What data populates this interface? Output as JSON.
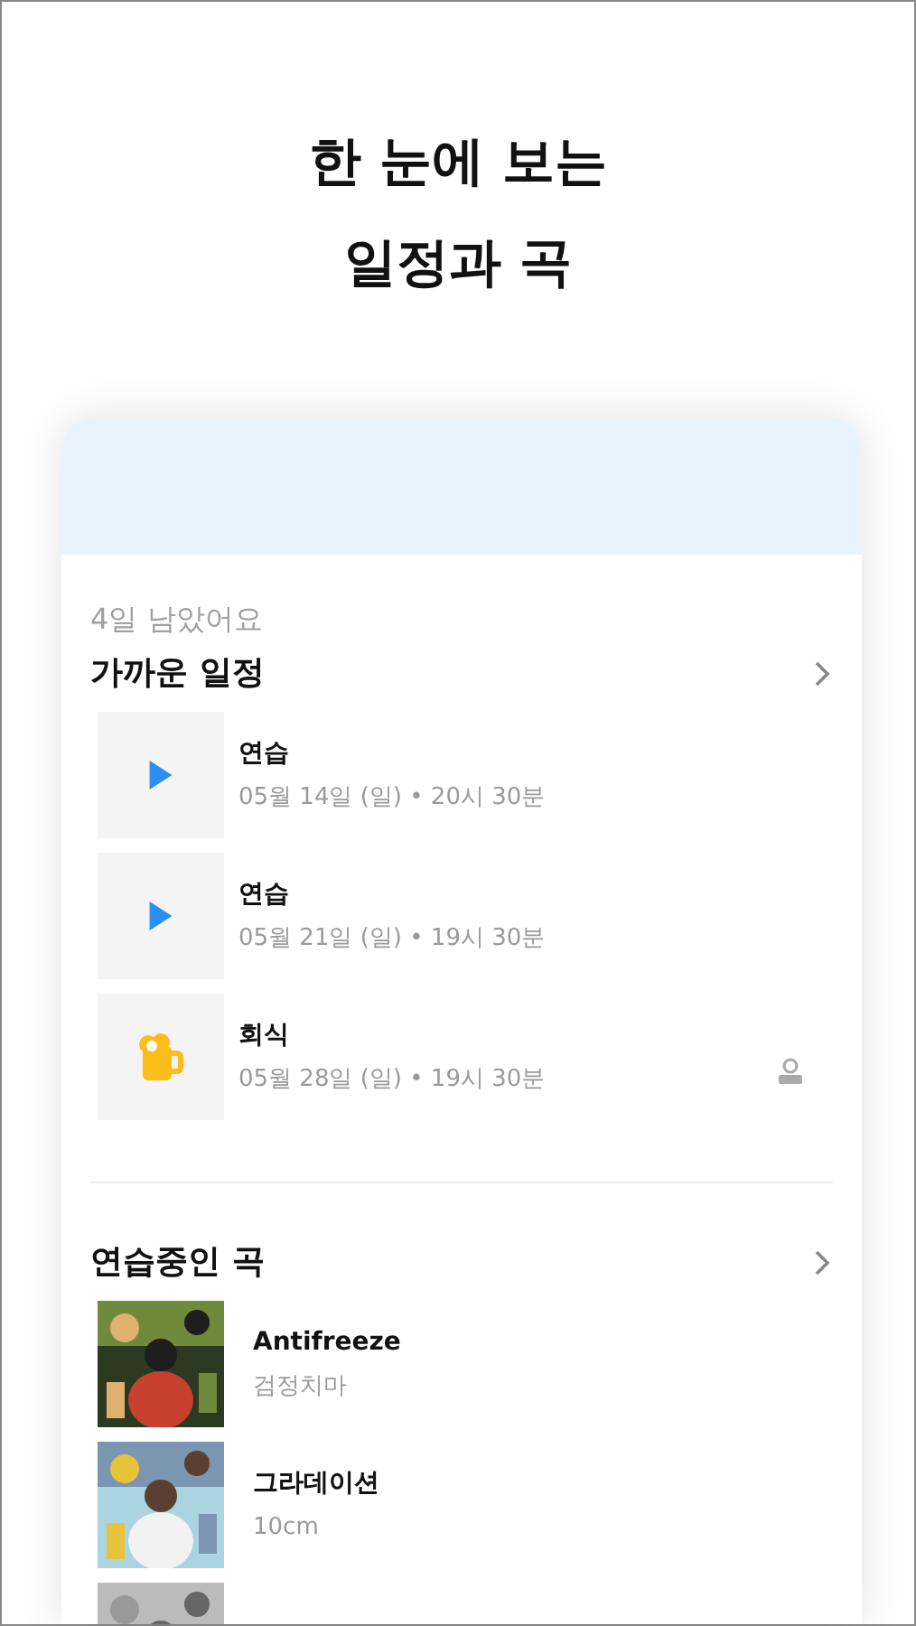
{
  "headline": [
    "한 눈에 보는",
    "일정과 곡"
  ],
  "schedule": {
    "remaining": "4일 남았어요",
    "title": "가까운 일정",
    "items": [
      {
        "kind": "practice",
        "title": "연습",
        "when": "05월 14일 (일) • 20시 30분",
        "flagged": false
      },
      {
        "kind": "practice",
        "title": "연습",
        "when": "05월 21일 (일) • 19시 30분",
        "flagged": false
      },
      {
        "kind": "party",
        "title": "회식",
        "when": "05월 28일 (일) • 19시 30분",
        "flagged": true
      }
    ]
  },
  "songs": {
    "title": "연습중인 곡",
    "items": [
      {
        "kind": "song",
        "title": "Antifreeze",
        "artist": "검정치마"
      },
      {
        "kind": "song",
        "title": "그라데이션",
        "artist": "10cm"
      },
      {
        "kind": "picture"
      }
    ]
  }
}
